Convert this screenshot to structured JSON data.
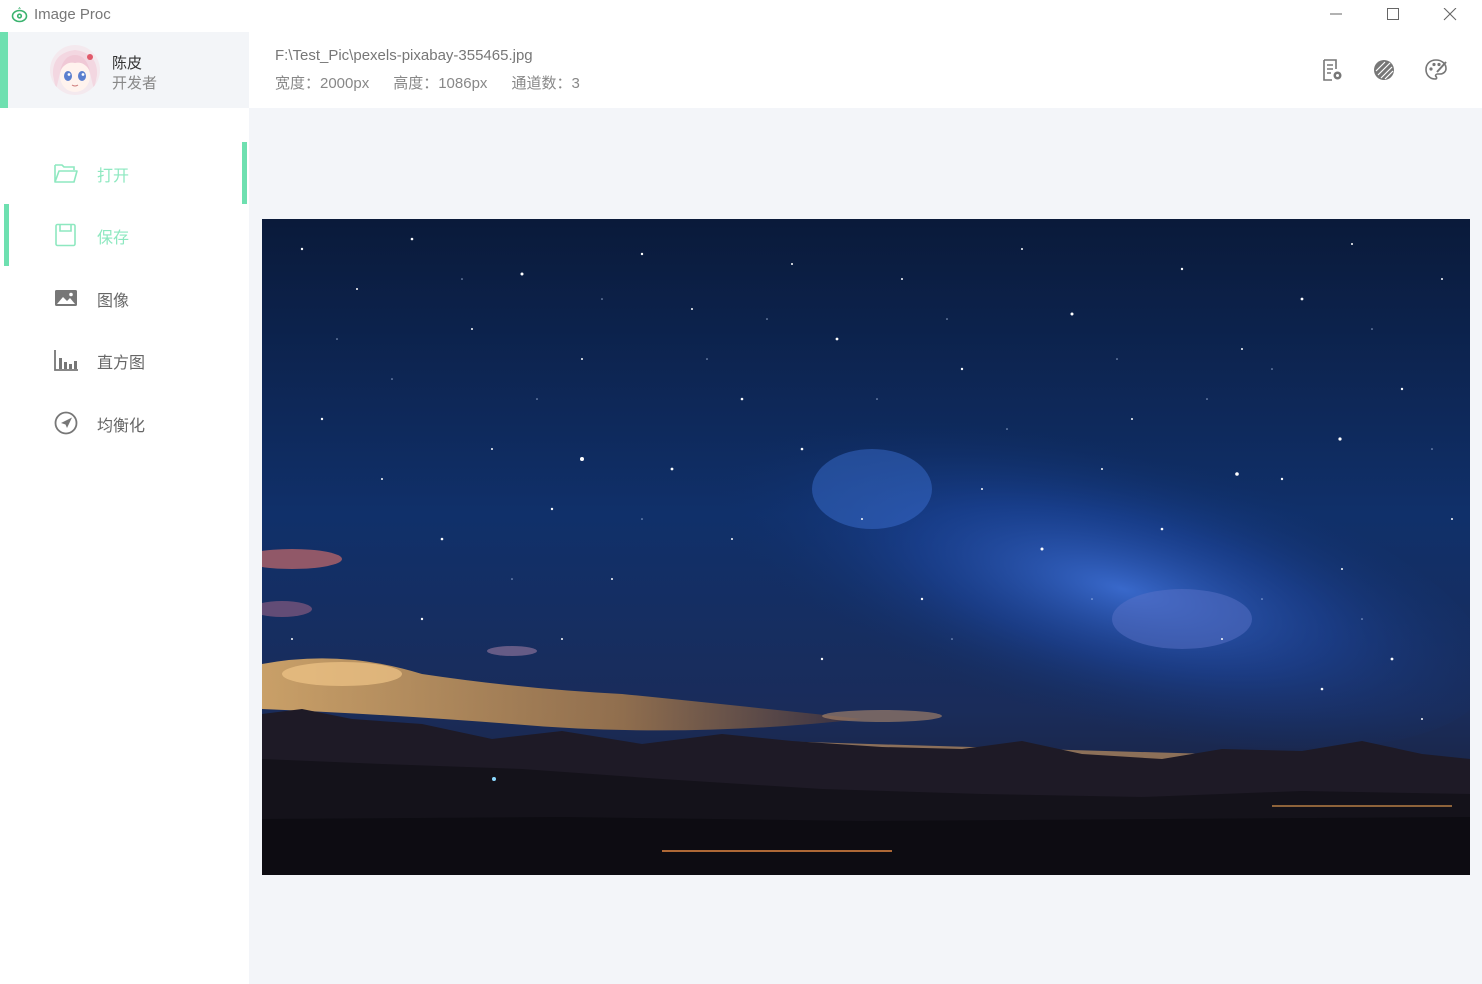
{
  "window": {
    "title": "Image Proc",
    "logo_icon": "app-eye-icon",
    "controls": {
      "minimize": "minimize-icon",
      "maximize": "maximize-icon",
      "close": "close-icon"
    }
  },
  "profile": {
    "name": "陈皮",
    "role": "开发者",
    "avatar": "anime-avatar"
  },
  "nav": {
    "items": [
      {
        "label": "打开",
        "icon": "folder-open-icon"
      },
      {
        "label": "保存",
        "icon": "save-icon"
      },
      {
        "label": "图像",
        "icon": "image-icon"
      },
      {
        "label": "直方图",
        "icon": "histogram-icon"
      },
      {
        "label": "均衡化",
        "icon": "compass-icon"
      }
    ]
  },
  "file": {
    "path": "F:\\Test_Pic\\pexels-pixabay-355465.jpg",
    "width": "宽度：2000px",
    "height": "高度：1086px",
    "channels": "通道数：3"
  },
  "toolbar": {
    "icons": [
      "document-settings-icon",
      "contrast-icon",
      "palette-icon"
    ]
  },
  "colors": {
    "accent": "#6ee0b0",
    "accent_light": "#8ee8c0",
    "panel_bg": "#f3f5f9"
  }
}
